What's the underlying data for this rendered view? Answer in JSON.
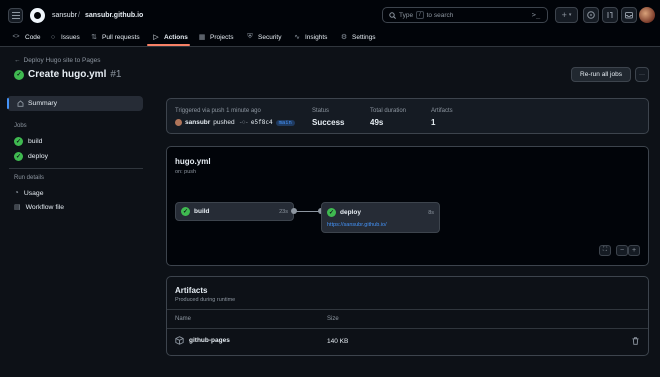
{
  "header": {
    "owner": "sansubr",
    "separator": "/",
    "repo": "sansubr.github.io",
    "search_prefix": "Type",
    "search_key": "/",
    "search_suffix": "to search",
    "plus_label": "+",
    "icons": [
      "menu-icon",
      "github-logo-icon",
      "search-icon",
      "terminal-icon",
      "plus-icon",
      "chevron-down-icon",
      "issues-icon",
      "pull-request-icon",
      "inbox-icon",
      "avatar"
    ]
  },
  "tabs": [
    {
      "label": "Code",
      "icon": "<>"
    },
    {
      "label": "Issues",
      "icon": "○"
    },
    {
      "label": "Pull requests",
      "icon": "⇅"
    },
    {
      "label": "Actions",
      "icon": "▷"
    },
    {
      "label": "Projects",
      "icon": "▦"
    },
    {
      "label": "Security",
      "icon": "⛨"
    },
    {
      "label": "Insights",
      "icon": "∿"
    },
    {
      "label": "Settings",
      "icon": "⚙"
    }
  ],
  "run": {
    "back_label": "Deploy Hugo site to Pages",
    "title": "Create hugo.yml",
    "run_number": "#1",
    "rerun_label": "Re-run all jobs",
    "more_label": "···"
  },
  "sidebar": {
    "summary": "Summary",
    "jobs_heading": "Jobs",
    "jobs": [
      "build",
      "deploy"
    ],
    "details_heading": "Run details",
    "details": [
      "Usage",
      "Workflow file"
    ]
  },
  "summary_card": {
    "trigger_label": "Triggered via push 1 minute ago",
    "actor": "sansubr",
    "action": "pushed",
    "commit": "e5f8c4",
    "branch": "main",
    "status_label": "Status",
    "status_value": "Success",
    "duration_label": "Total duration",
    "duration_value": "49s",
    "artifacts_label": "Artifacts",
    "artifacts_value": "1"
  },
  "workflow": {
    "name": "hugo.yml",
    "trigger": "on: push",
    "jobs": [
      {
        "name": "build",
        "duration": "23s"
      },
      {
        "name": "deploy",
        "duration": "8s",
        "url": "https://sansubr.github.io/"
      }
    ],
    "zoom_out": "−",
    "zoom_in": "+"
  },
  "artifacts": {
    "heading": "Artifacts",
    "subheading": "Produced during runtime",
    "col_name": "Name",
    "col_size": "Size",
    "rows": [
      {
        "name": "github-pages",
        "size": "140 KB"
      }
    ]
  },
  "colors": {
    "background": "#0d1117",
    "header": "#010409",
    "border": "#3d444d",
    "success": "#3fb950",
    "accent": "#f78166",
    "link": "#4493f8"
  }
}
